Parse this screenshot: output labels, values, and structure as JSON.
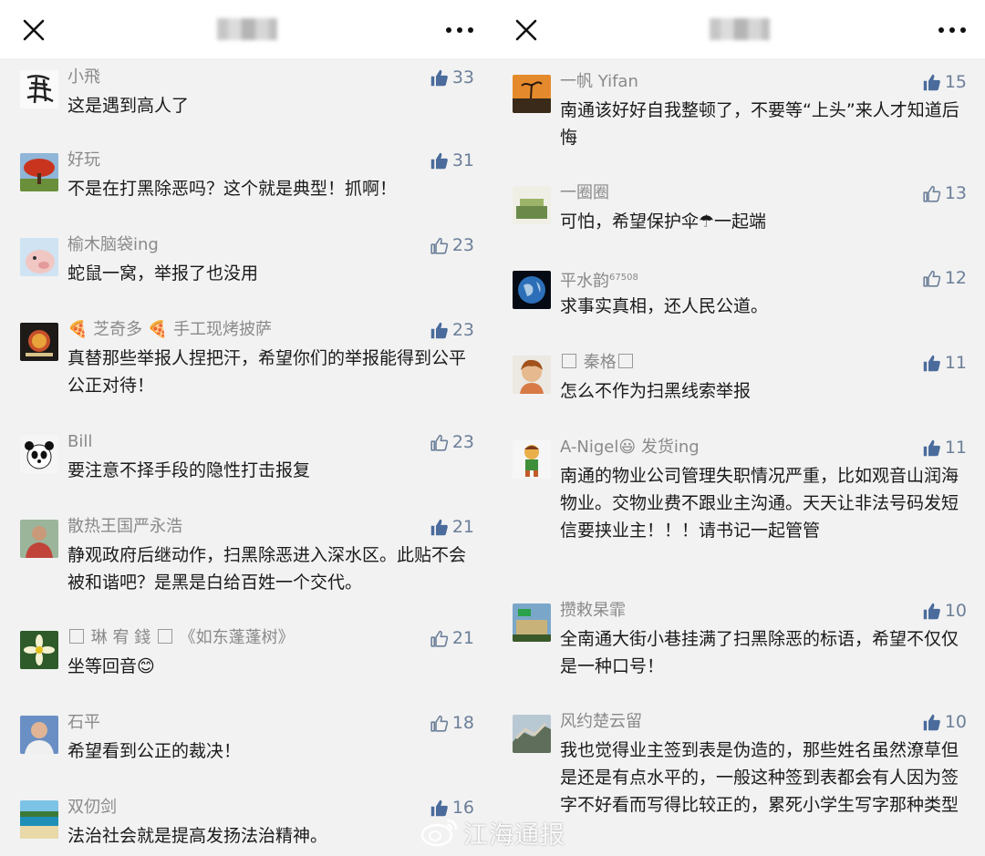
{
  "colors": {
    "like_active": "#4a6b9c",
    "like_outline": "#6c7f99",
    "name_gray": "#8a8a8a"
  },
  "watermark": "江海通报",
  "left": {
    "comments": [
      {
        "name": "小飛",
        "text": "这是遇到高人了",
        "likes": "33",
        "liked": true,
        "avatar": "calligraphy-avatar"
      },
      {
        "name": "好玩",
        "text": "不是在打黑除恶吗？这个就是典型！抓啊！",
        "likes": "31",
        "liked": true,
        "avatar": "tree-avatar"
      },
      {
        "name": "榆木脑袋ing",
        "text": "蛇鼠一窝，举报了也没用",
        "likes": "23",
        "liked": false,
        "avatar": "pig-avatar"
      },
      {
        "name": "🍕 芝奇多 🍕 手工现烤披萨",
        "text": "真替那些举报人捏把汗，希望你们的举报能得到公平公正对待！",
        "likes": "23",
        "liked": true,
        "avatar": "pizza-logo-avatar"
      },
      {
        "name": "Bill",
        "text": "要注意不择手段的隐性打击报复",
        "likes": "23",
        "liked": false,
        "avatar": "panda-avatar"
      },
      {
        "name": "散热王国严永浩",
        "text": "静观政府后继动作，扫黑除恶进入深水区。此贴不会被和谐吧？是黑是白给百姓一个交代。",
        "likes": "21",
        "liked": true,
        "avatar": "man-avatar"
      },
      {
        "name_parts": [
          "琳 宥 錢",
          "《如东蓬蓬树》"
        ],
        "text": "坐等回音😊",
        "likes": "21",
        "liked": false,
        "avatar": "flower-avatar"
      },
      {
        "name": "石平",
        "text": "希望看到公正的裁决！",
        "likes": "18",
        "liked": false,
        "avatar": "portrait-avatar"
      },
      {
        "name": "双仞剑",
        "text": "法治社会就是提高发扬法治精神。",
        "likes": "16",
        "liked": true,
        "avatar": "beach-avatar"
      }
    ]
  },
  "right": {
    "comments": [
      {
        "name": "一帆 Yifan",
        "text": "南通该好好自我整顿了，不要等“上头”来人才知道后悔",
        "likes": "15",
        "liked": true,
        "avatar": "sunset-avatar"
      },
      {
        "name": "一圈圈",
        "text": "可怕，希望保护伞☂一起端",
        "likes": "13",
        "liked": false,
        "avatar": "plant-avatar"
      },
      {
        "name": "平水韵",
        "name_sup": "67508",
        "text": "求事实真相，还人民公道。",
        "likes": "12",
        "liked": false,
        "avatar": "earth-avatar"
      },
      {
        "name_parts": [
          "",
          "秦格",
          ""
        ],
        "text": "怎么不作为扫黑线索举报",
        "likes": "11",
        "liked": true,
        "avatar": "child-avatar"
      },
      {
        "name": "A-Nigel😃 发货ing",
        "text": "南通的物业公司管理失职情况严重，比如观音山润海物业。交物业费不跟业主沟通。天天让非法号码发短信要挟业主！！！请书记一起管管",
        "likes": "11",
        "liked": true,
        "avatar": "cartoon-avatar"
      },
      {
        "name": "攒敕杲霏",
        "text": "全南通大街小巷挂满了扫黑除恶的标语，希望不仅仅是一种口号！",
        "likes": "10",
        "liked": true,
        "avatar": "building-avatar"
      },
      {
        "name": "风约楚云留",
        "text": "我也觉得业主签到表是伪造的，那些姓名虽然潦草但是还是有点水平的，一般这种签到表都会有人因为签字不好看而写得比较正的，累死小学生写字那种类型",
        "likes": "10",
        "liked": true,
        "avatar": "wall-avatar"
      }
    ]
  }
}
